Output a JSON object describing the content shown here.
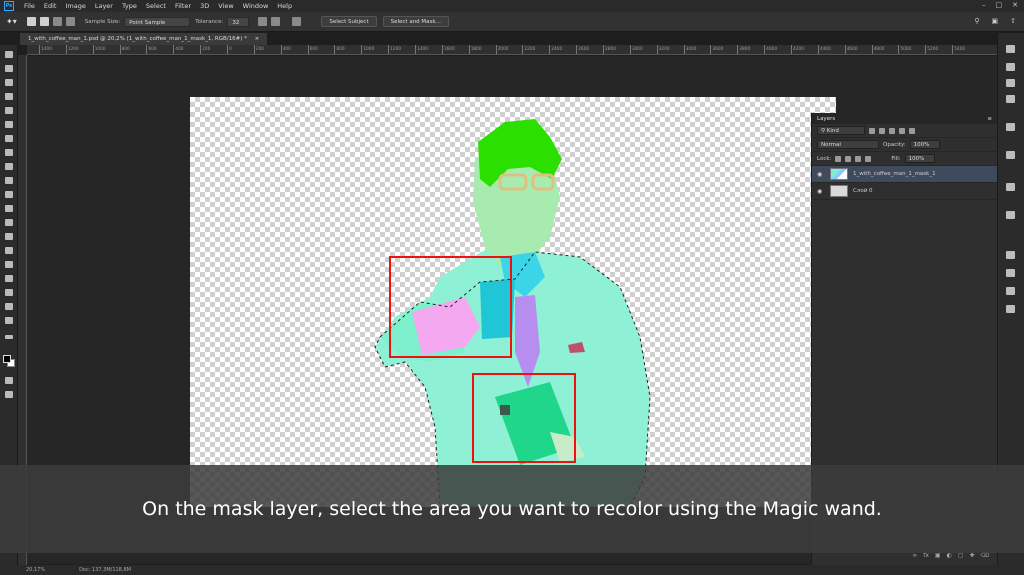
{
  "menubar": {
    "items": [
      "File",
      "Edit",
      "Image",
      "Layer",
      "Type",
      "Select",
      "Filter",
      "3D",
      "View",
      "Window",
      "Help"
    ]
  },
  "options": {
    "sample_size_label": "Sample Size:",
    "sample_size_value": "Point Sample",
    "tolerance_label": "Tolerance:",
    "tolerance_value": "32",
    "select_subject": "Select Subject",
    "select_and_mask": "Select and Mask..."
  },
  "document": {
    "tab_title": "1_with_coffee_man_1.psd @ 20,2% (1_with_coffee_man_1_mask_1, RGB/16#) *",
    "ruler_ticks": [
      "1400",
      "1200",
      "1000",
      "800",
      "600",
      "400",
      "200",
      "0",
      "200",
      "400",
      "600",
      "800",
      "1000",
      "1200",
      "1400",
      "1600",
      "1800",
      "2000",
      "2200",
      "2400",
      "2600",
      "2800",
      "3000",
      "3200",
      "3400",
      "3600",
      "3800",
      "4000",
      "4200",
      "4400",
      "4600",
      "4800",
      "5000",
      "5200",
      "5400"
    ]
  },
  "layers_panel": {
    "title": "Layers",
    "kind_label": "Kind",
    "blend_mode": "Normal",
    "opacity_label": "Opacity:",
    "opacity_value": "100%",
    "lock_label": "Lock:",
    "fill_label": "Fill:",
    "fill_value": "100%",
    "layers": [
      {
        "name": "1_with_coffee_man_1_mask_1",
        "selected": true
      },
      {
        "name": "Слой 0",
        "selected": false
      }
    ]
  },
  "status": {
    "zoom": "20,17%",
    "doc_info": "Doc: 137,3M/118,8M"
  },
  "caption": "On the mask layer, select the area you want to recolor using the Magic wand.",
  "colors": {
    "highlight": "#e11111",
    "mint": "#7ef0cc",
    "hair": "#2be000"
  }
}
